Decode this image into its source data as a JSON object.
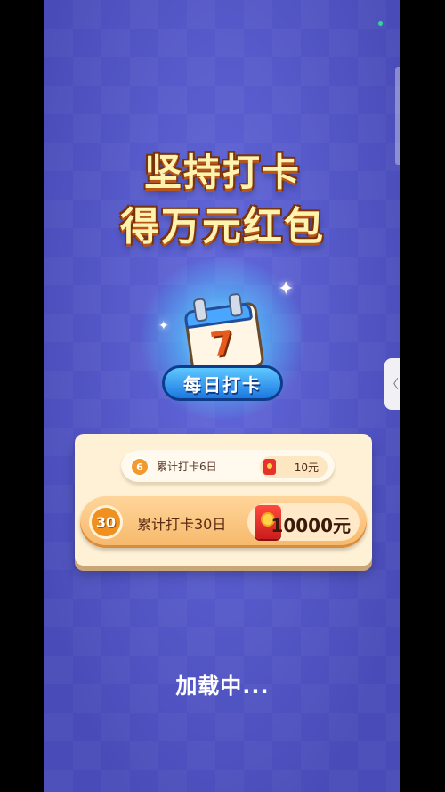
{
  "banner": {
    "title_line1": "坚持打卡",
    "title_line2": "得万元红包"
  },
  "badge": {
    "calendar_number": "7",
    "label": "每日打卡"
  },
  "rewards": {
    "small": {
      "day_number": "6",
      "label": "累计打卡6日",
      "amount": "10元",
      "icon": "red-envelope-icon"
    },
    "big": {
      "day_number": "30",
      "label": "累计打卡30日",
      "amount": "10000元",
      "icon": "red-envelope-icon"
    }
  },
  "status": {
    "loading_text": "加载中..."
  },
  "side_tab": {
    "icon_glyph": "〈"
  },
  "colors": {
    "background": "#5b5fd0",
    "title_fill": "#fff3b0",
    "badge_blue": "#1c78e0",
    "card_cream": "#fff1d6",
    "reward_orange": "#f6b86a",
    "envelope_red": "#e8312c"
  }
}
